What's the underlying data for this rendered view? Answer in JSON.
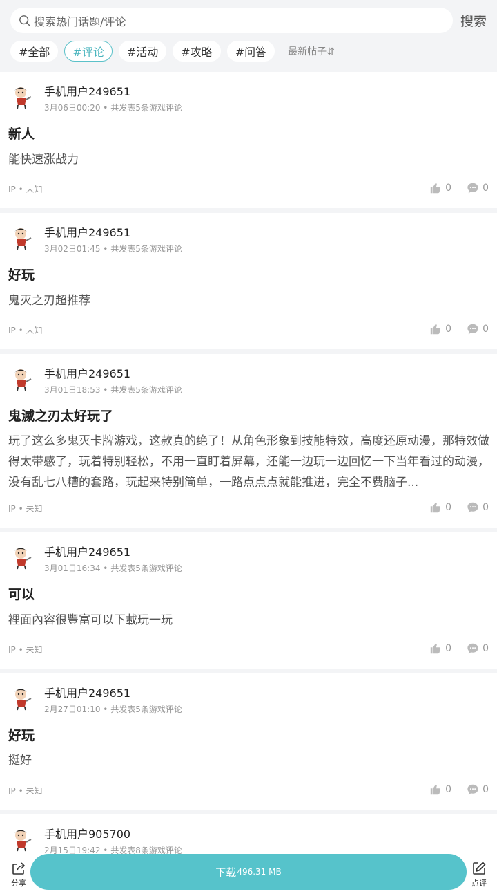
{
  "search": {
    "placeholder": "搜索热门话题/评论",
    "button": "搜索"
  },
  "tags": [
    "#全部",
    "#评论",
    "#活动",
    "#攻略",
    "#问答"
  ],
  "active_tag": "#评论",
  "sort_label": "最新帖子⇵",
  "posts": [
    {
      "user": "手机用户249651",
      "meta": "3月06日00:20 • 共发表5条游戏评论",
      "title": "新人",
      "body": "能快速涨战力",
      "ip": "IP • 未知",
      "likes": "0",
      "comments": "0"
    },
    {
      "user": "手机用户249651",
      "meta": "3月02日01:45 • 共发表5条游戏评论",
      "title": "好玩",
      "body": "鬼灭之刃超推荐",
      "ip": "IP • 未知",
      "likes": "0",
      "comments": "0"
    },
    {
      "user": "手机用户249651",
      "meta": "3月01日18:53 • 共发表5条游戏评论",
      "title": "鬼滅之刃太好玩了",
      "body": "玩了这么多鬼灭卡牌游戏，这款真的绝了！从角色形象到技能特效，高度还原动漫，那特效做得太带感了，玩着特别轻松，不用一直盯着屏幕，还能一边玩一边回忆一下当年看过的动漫，没有乱七八糟的套路，玩起来特别简单，一路点点点就能推进，完全不费脑子...",
      "ip": "IP • 未知",
      "likes": "0",
      "comments": "0"
    },
    {
      "user": "手机用户249651",
      "meta": "3月01日16:34 • 共发表5条游戏评论",
      "title": "可以",
      "body": "裡面內容很豐富可以下載玩一玩",
      "ip": "IP • 未知",
      "likes": "0",
      "comments": "0"
    },
    {
      "user": "手机用户249651",
      "meta": "2月27日01:10 • 共发表5条游戏评论",
      "title": "好玩",
      "body": "挺好",
      "ip": "IP • 未知",
      "likes": "0",
      "comments": "0"
    },
    {
      "user": "手机用户905700",
      "meta": "2月15日19:42 • 共发表8条游戏评论",
      "title": "",
      "body": "",
      "ip": "",
      "likes": "",
      "comments": ""
    }
  ],
  "bottom": {
    "share": "分享",
    "download": "下载",
    "download_size": "496.31 MB",
    "review": "点评"
  },
  "colors": {
    "accent": "#56c3cb",
    "background": "#f3f4f6"
  }
}
